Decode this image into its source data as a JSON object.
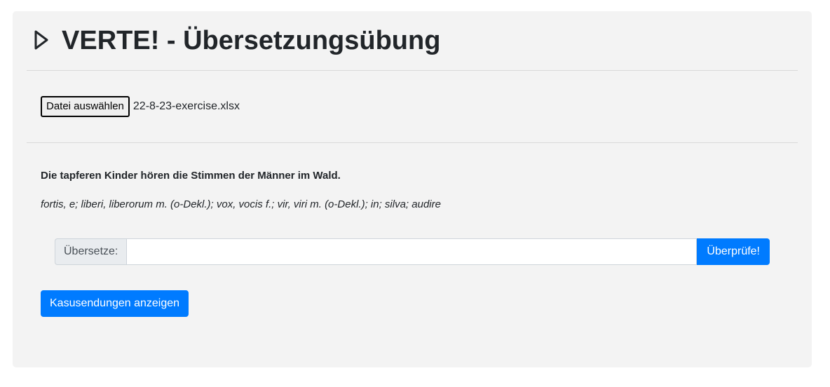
{
  "header": {
    "icon": "play-icon",
    "title": "VERTE! - Übersetzungsübung"
  },
  "file_picker": {
    "button_label": "Datei auswählen",
    "file_name": "22-8-23-exercise.xlsx"
  },
  "exercise": {
    "sentence": "Die tapferen Kinder hören die Stimmen der Männer im Wald.",
    "vocabulary": "fortis, e; liberi, liberorum m. (o-Dekl.); vox, vocis f.; vir, viri m. (o-Dekl.); in; silva; audire"
  },
  "translate": {
    "prefix_label": "Übersetze:",
    "input_value": "",
    "check_button_label": "Überprüfe!"
  },
  "case_endings_button_label": "Kasusendungen anzeigen",
  "colors": {
    "primary": "#007bff",
    "card_background": "#f3f3f3",
    "text": "#212529"
  }
}
